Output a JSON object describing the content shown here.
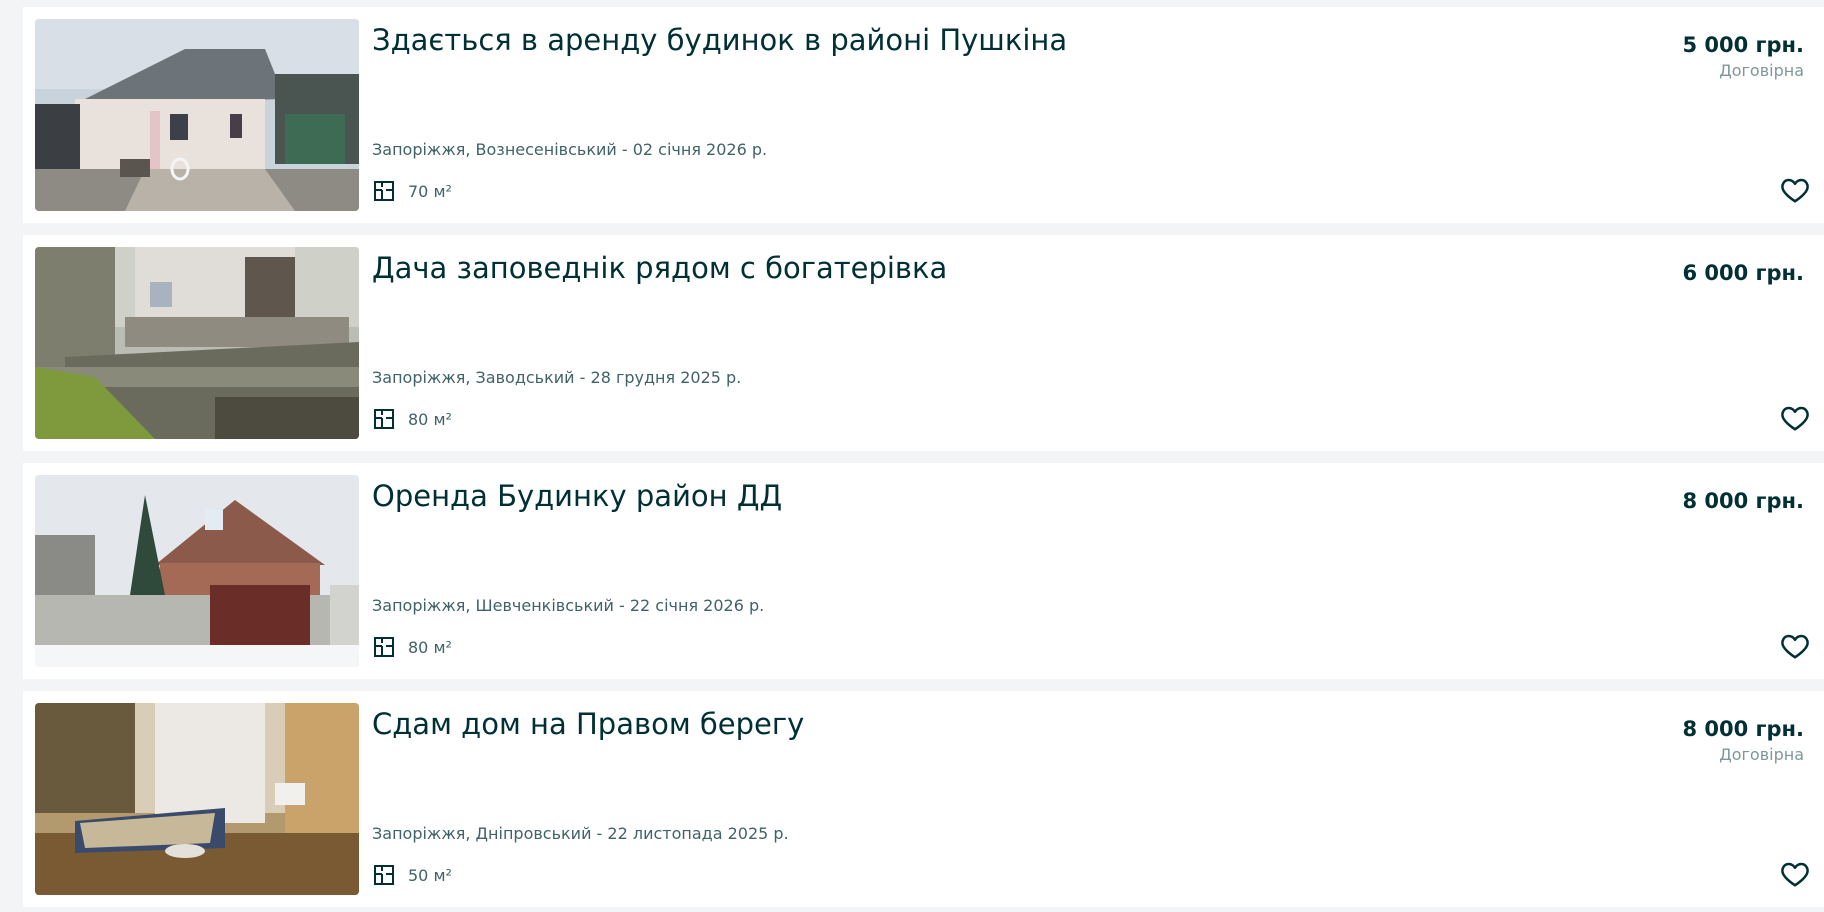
{
  "listings": [
    {
      "title": "Здається в аренду будинок в районі Пушкіна",
      "price": "5 000 грн.",
      "negotiable": "Договірна",
      "location": "Запоріжжя, Вознесенівський - 02 січня 2026 р.",
      "area": "70 м²"
    },
    {
      "title": "Дача заповеднік рядом с богатерівка",
      "price": "6 000 грн.",
      "negotiable": "",
      "location": "Запоріжжя, Заводський - 28 грудня 2025 р.",
      "area": "80 м²"
    },
    {
      "title": "Оренда Будинку район ДД",
      "price": "8 000 грн.",
      "negotiable": "",
      "location": "Запоріжжя, Шевченківський - 22 січня 2026 р.",
      "area": "80 м²"
    },
    {
      "title": "Сдам дом на Правом берегу",
      "price": "8 000 грн.",
      "negotiable": "Договірна",
      "location": "Запоріжжя, Дніпровський - 22 листопада 2025 р.",
      "area": "50 м²"
    }
  ],
  "colors": {
    "text_primary": "#002f34",
    "text_secondary": "#406367",
    "text_muted": "#7f9799",
    "page_bg": "#f2f4f5",
    "card_bg": "#ffffff"
  },
  "icons": {
    "area": "floor-plan-icon",
    "favorite": "heart-outline-icon"
  }
}
